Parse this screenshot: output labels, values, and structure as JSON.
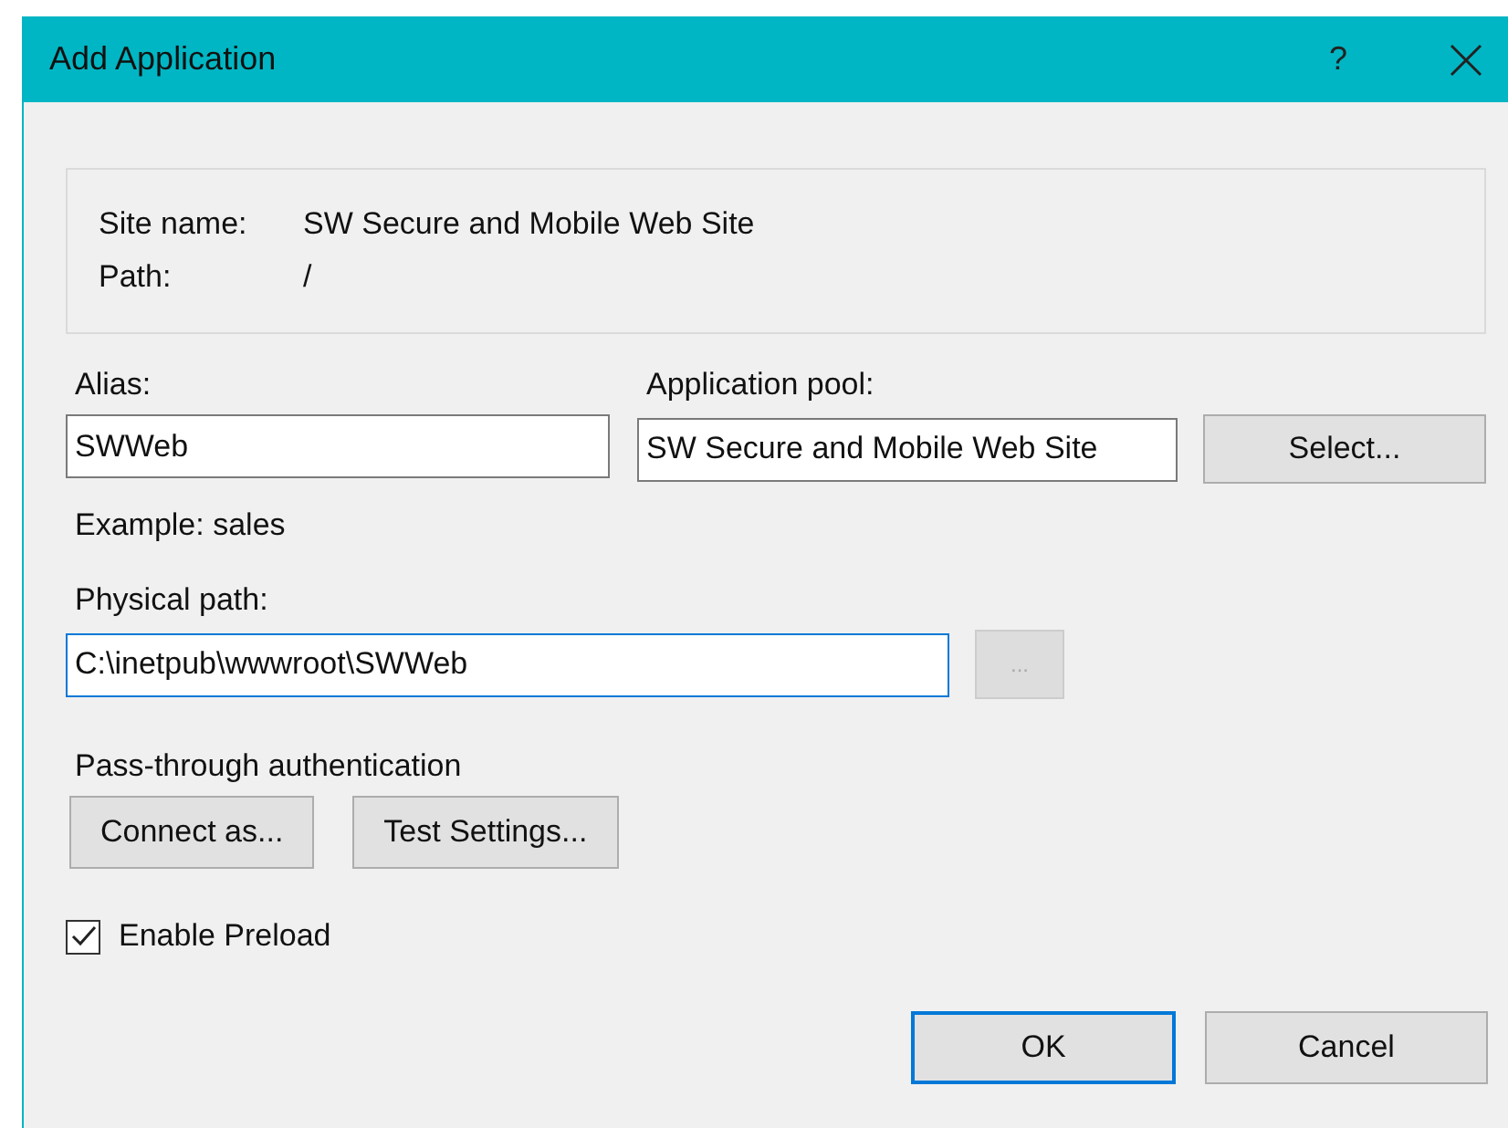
{
  "window": {
    "title": "Add Application",
    "help": "?"
  },
  "site_info": [
    {
      "label": "Site name:",
      "value": "SW Secure and Mobile Web Site"
    },
    {
      "label": "Path:",
      "value": "/"
    }
  ],
  "alias": {
    "label": "Alias:",
    "value": "SWWeb",
    "hint": "Example: sales"
  },
  "application_pool": {
    "label": "Application pool:",
    "value": "SW Secure and Mobile Web Site",
    "button": "Select..."
  },
  "physical_path": {
    "label": "Physical path:",
    "value": "C:\\inetpub\\wwwroot\\SWWeb",
    "focused": true,
    "browse_button": {
      "label": "...",
      "disabled": true
    }
  },
  "pass_through": {
    "label": "Pass-through authentication",
    "buttons": [
      "Connect as...",
      "Test Settings..."
    ]
  },
  "enable_preload": {
    "label": "Enable Preload",
    "checked": true
  },
  "buttons": [
    {
      "label": "OK",
      "default": true
    },
    {
      "label": "Cancel",
      "default": false
    }
  ]
}
